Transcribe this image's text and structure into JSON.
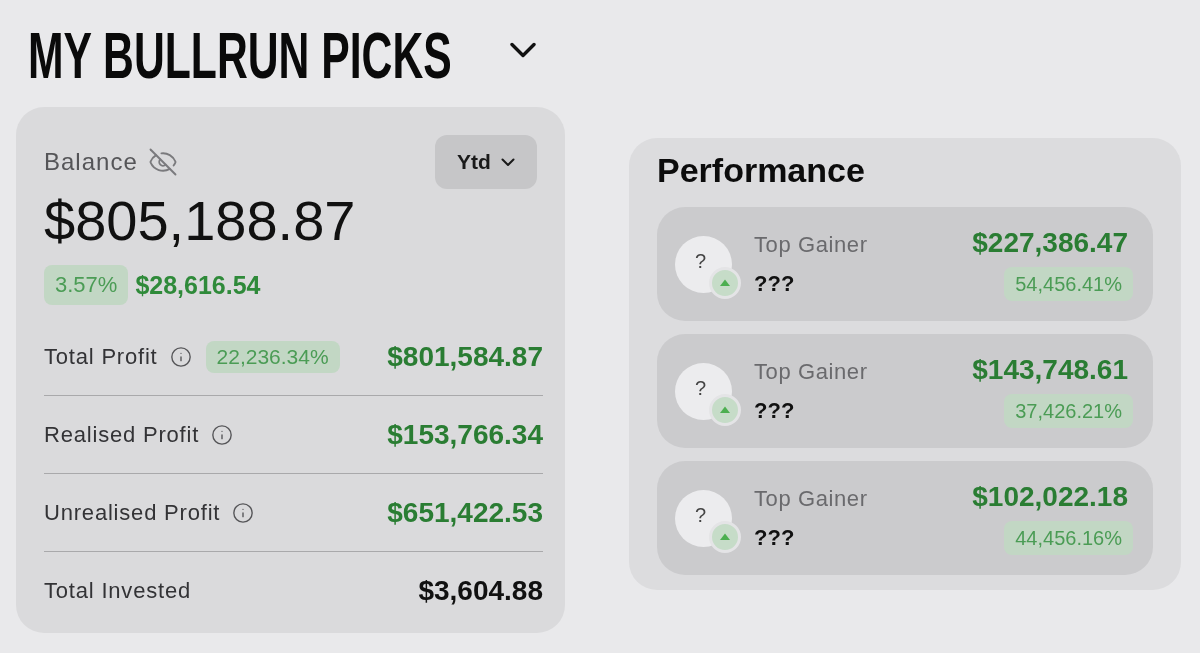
{
  "header": {
    "title": "MY BULLRUN PICKS"
  },
  "balance_card": {
    "label": "Balance",
    "period": "Ytd",
    "amount": "$805,188.87",
    "change_percent": "3.57%",
    "change_amount": "$28,616.54",
    "rows": [
      {
        "label": "Total Profit",
        "info": true,
        "badge": "22,236.34%",
        "value": "$801,584.87",
        "positive": true
      },
      {
        "label": "Realised Profit",
        "info": true,
        "value": "$153,766.34",
        "positive": true
      },
      {
        "label": "Unrealised Profit",
        "info": true,
        "value": "$651,422.53",
        "positive": true
      },
      {
        "label": "Total Invested",
        "info": false,
        "value": "$3,604.88",
        "positive": false
      }
    ]
  },
  "performance": {
    "title": "Performance",
    "items": [
      {
        "avatar": "?",
        "label": "Top Gainer",
        "name": "???",
        "up": true,
        "value": "$227,386.47",
        "change": "54,456.41%"
      },
      {
        "avatar": "?",
        "label": "Top Gainer",
        "name": "???",
        "up": true,
        "value": "$143,748.61",
        "change": "37,426.21%"
      },
      {
        "avatar": "?",
        "label": "Top Gainer",
        "name": "???",
        "up": true,
        "value": "$102,022.18",
        "change": "44,456.16%"
      }
    ]
  }
}
